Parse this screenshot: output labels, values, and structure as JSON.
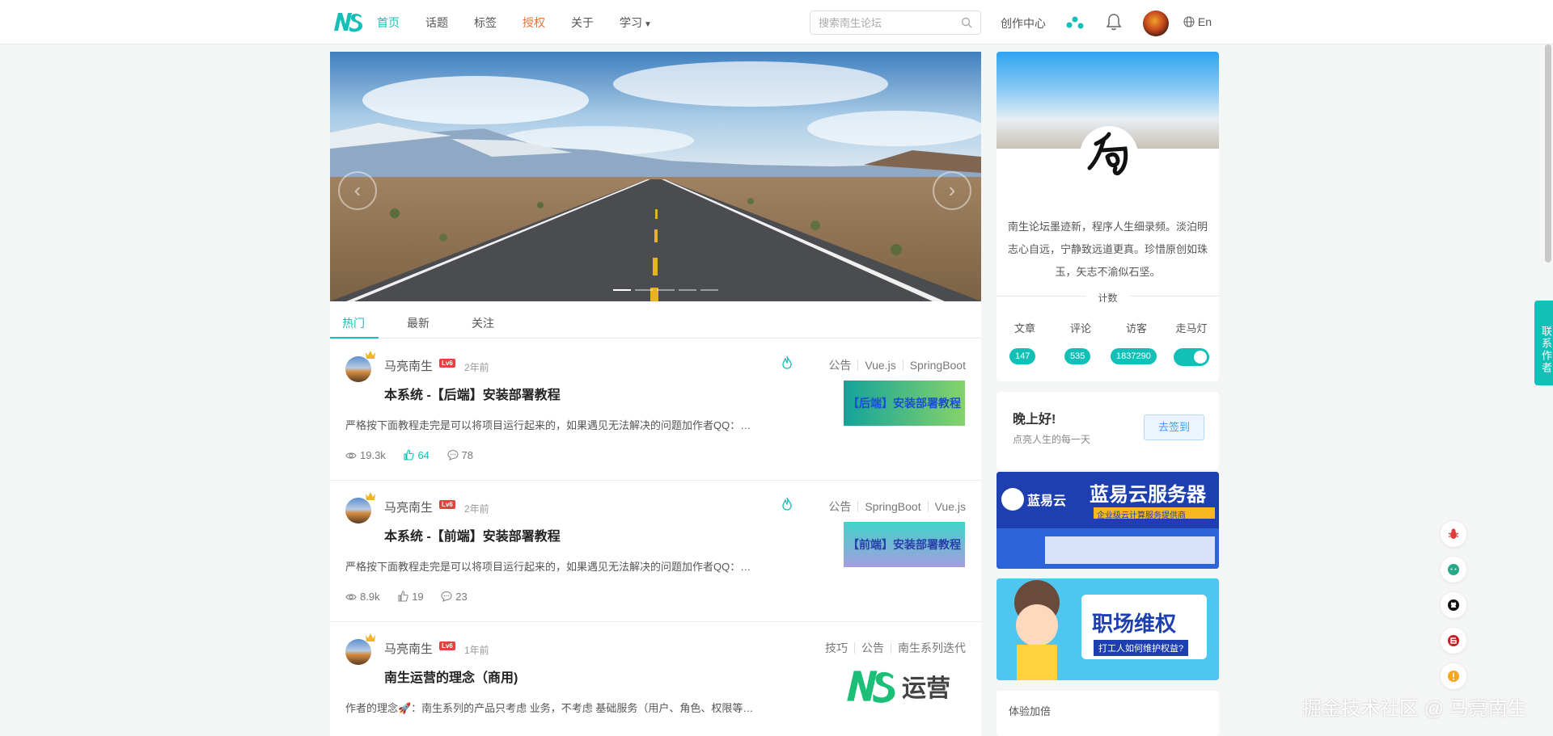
{
  "header": {
    "nav": [
      {
        "label": "首页",
        "active": true
      },
      {
        "label": "话题"
      },
      {
        "label": "标签"
      },
      {
        "label": "授权"
      },
      {
        "label": "关于"
      },
      {
        "label": "学习"
      }
    ],
    "search_placeholder": "搜索南生论坛",
    "creator_center": "创作中心",
    "lang": "En"
  },
  "feed": {
    "tabs": [
      "热门",
      "最新",
      "关注"
    ],
    "posts": [
      {
        "author": "马亮南生",
        "level": "Lv6",
        "time": "2年前",
        "tags": [
          "公告",
          "Vue.js",
          "SpringBoot"
        ],
        "title": "本系统 -【后端】安装部署教程",
        "summary": "严格按下面教程走完是可以将项目运行起来的，如果遇见无法解决的问题加作者QQ：…",
        "thumb": "【后端】安装部署教程",
        "views": "19.3k",
        "likes": "64",
        "comments": "78"
      },
      {
        "author": "马亮南生",
        "level": "Lv6",
        "time": "2年前",
        "tags": [
          "公告",
          "SpringBoot",
          "Vue.js"
        ],
        "title": "本系统 -【前端】安装部署教程",
        "summary": "严格按下面教程走完是可以将项目运行起来的，如果遇见无法解决的问题加作者QQ：…",
        "thumb": "【前端】安装部署教程",
        "views": "8.9k",
        "likes": "19",
        "comments": "23"
      },
      {
        "author": "马亮南生",
        "level": "Lv6",
        "time": "1年前",
        "tags": [
          "技巧",
          "公告",
          "南生系列迭代"
        ],
        "title": "南生运营的理念（商用)",
        "summary": "作者的理念🚀：南生系列的产品只考虑 业务，不考虑 基础服务（用户、角色、权限等…",
        "thumb": "运营"
      }
    ]
  },
  "profile": {
    "desc": "南生论坛墨迹新，程序人生细录频。淡泊明志心自远，宁静致远道更真。珍惜原创如珠玉，矢志不渝似石坚。",
    "count_title": "计数",
    "counts": [
      {
        "label": "文章",
        "value": "147"
      },
      {
        "label": "评论",
        "value": "535"
      },
      {
        "label": "访客",
        "value": "1837290"
      },
      {
        "label": "走马灯",
        "toggle": true
      }
    ]
  },
  "greet": {
    "title": "晚上好!",
    "sub": "点亮人生的每一天",
    "button": "去签到"
  },
  "ads": {
    "ad1_brand": "蓝易云",
    "ad1_title": "蓝易云服务器",
    "ad1_sub": "企业级云计算服务提供商",
    "ad2_title": "职场维权",
    "ad2_sub": "打工人如何维护权益?"
  },
  "faith": "体验加倍",
  "contact": "联系作者",
  "watermark": "掘金技术社区 @ 马亮南生",
  "colors": {
    "accent": "#13c0b7",
    "license": "#e8743c",
    "level": "#e64040"
  }
}
